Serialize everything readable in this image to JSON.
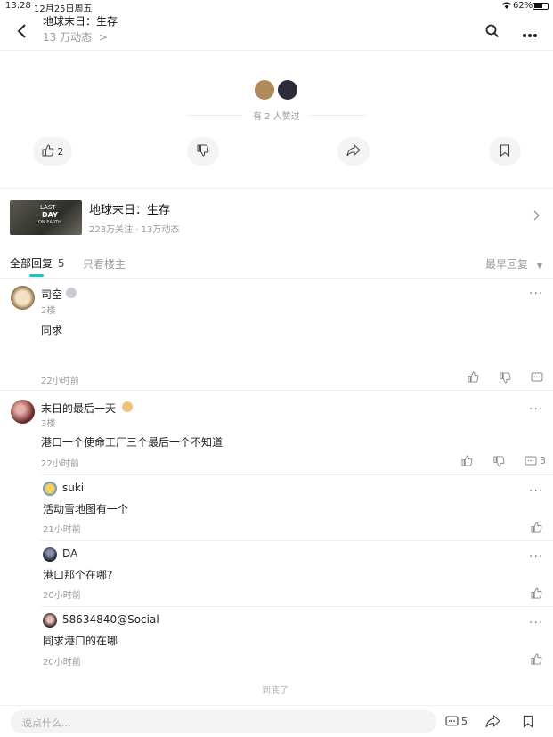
{
  "status_bar": {
    "time": "13:28",
    "date": "12月25日周五",
    "battery": "62%"
  },
  "header": {
    "title": "地球末日：生存",
    "subtitle": "13 万动态",
    "subtitle_arrow": ">"
  },
  "likes": {
    "text": "有 2 人赞过"
  },
  "actions": {
    "like_count": "2"
  },
  "game_card": {
    "title": "地球末日：生存",
    "stats": "223万关注 · 13万动态",
    "thumb_text_line1": "LAST",
    "thumb_text_line2": "DAY",
    "thumb_text_line3": "ON EARTH"
  },
  "tabs": {
    "all_replies": "全部回复",
    "all_count": "5",
    "author_only": "只看楼主",
    "sort": "最早回复"
  },
  "replies": [
    {
      "name": "司空",
      "floor": "2楼",
      "content": "同求",
      "time": "22小时前"
    },
    {
      "name": "末日的最后一天",
      "floor": "3楼",
      "content": "港口一个使命工厂三个最后一个不知道",
      "time": "22小时前",
      "reply_count": "3",
      "sub_replies": [
        {
          "name": "suki",
          "content": "活动雪地图有一个",
          "time": "21小时前"
        },
        {
          "name": "DA",
          "content": "港口那个在哪?",
          "time": "20小时前"
        },
        {
          "name": "58634840@Social",
          "content": "同求港口的在哪",
          "time": "20小时前"
        }
      ]
    }
  ],
  "end_text": "到底了",
  "bottom_bar": {
    "placeholder": "说点什么...",
    "comment_count": "5"
  }
}
